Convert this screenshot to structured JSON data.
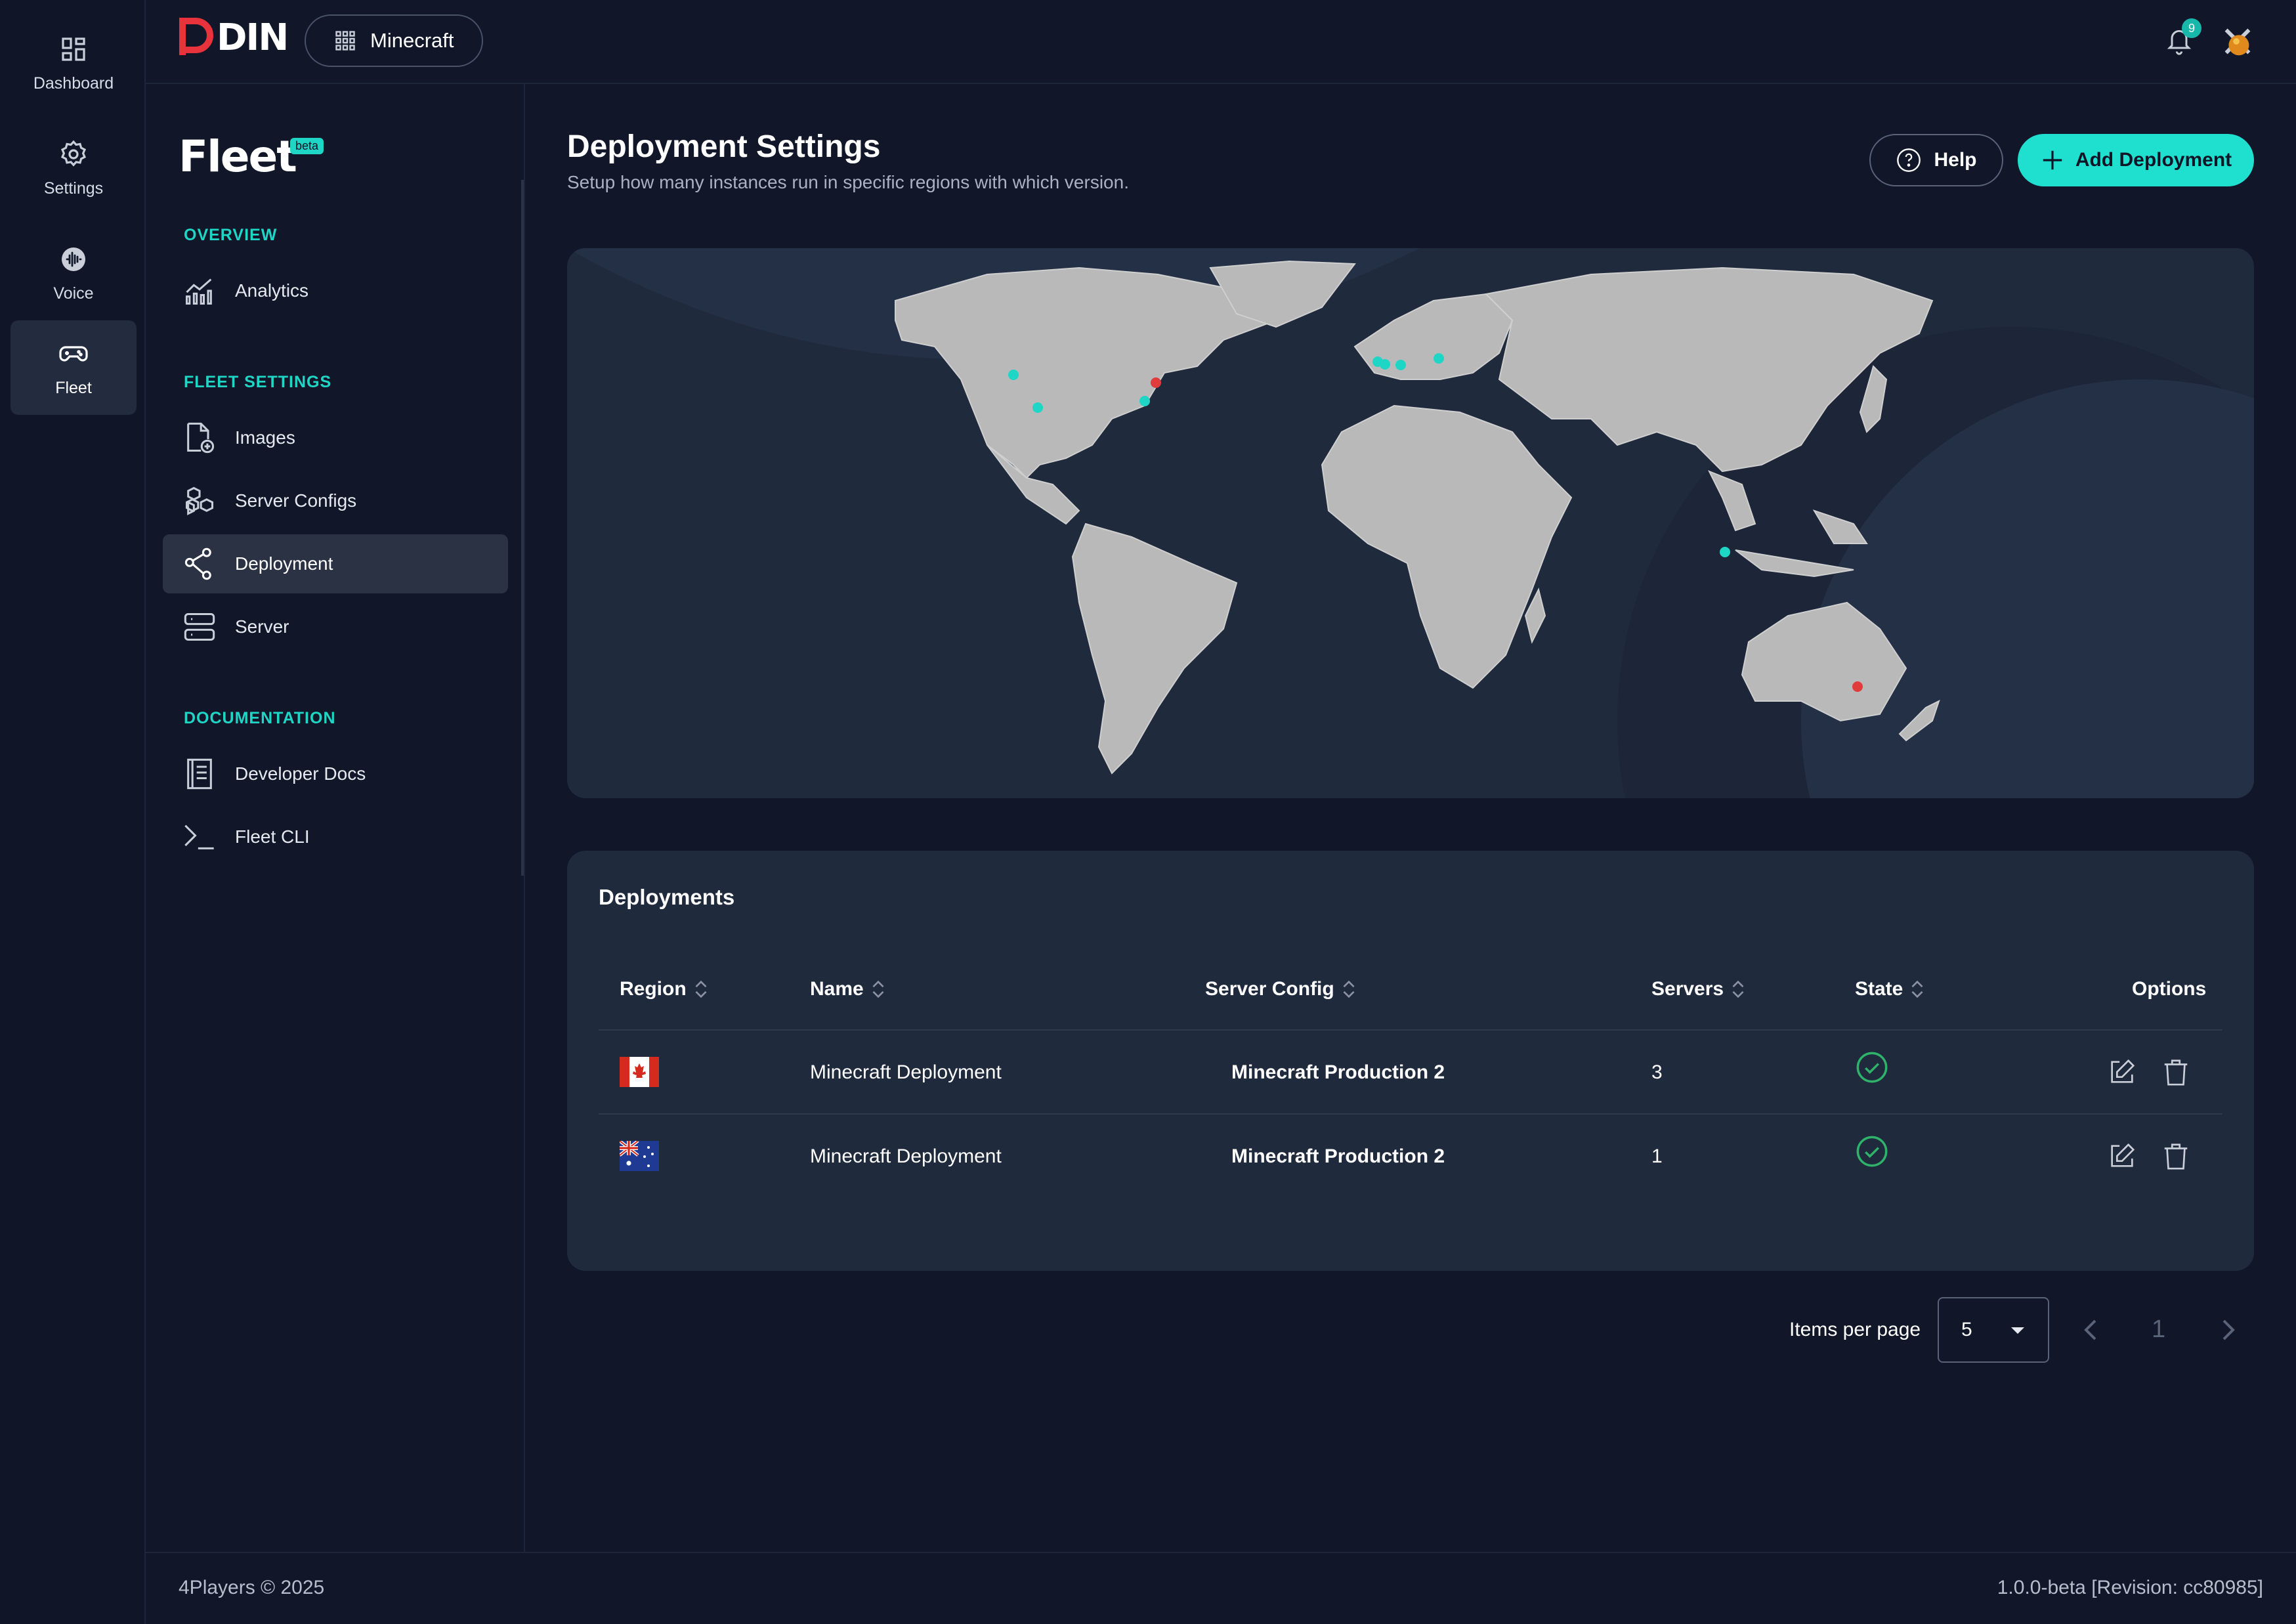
{
  "rail": {
    "items": [
      {
        "label": "Dashboard",
        "icon": "dashboard-icon"
      },
      {
        "label": "Settings",
        "icon": "gear-icon"
      },
      {
        "label": "Voice",
        "icon": "voice-icon"
      },
      {
        "label": "Fleet",
        "icon": "gamepad-icon",
        "active": true
      }
    ]
  },
  "topbar": {
    "logo_text": "DIN",
    "project": "Minecraft",
    "notification_count": "9"
  },
  "subnav": {
    "title": "Fleet",
    "badge": "beta",
    "sections": {
      "overview": "OVERVIEW",
      "fleet_settings": "FLEET SETTINGS",
      "documentation": "DOCUMENTATION"
    },
    "items": {
      "analytics": "Analytics",
      "images": "Images",
      "server_configs": "Server Configs",
      "deployment": "Deployment",
      "server": "Server",
      "developer_docs": "Developer Docs",
      "fleet_cli": "Fleet CLI"
    },
    "active": "deployment"
  },
  "header": {
    "title": "Deployment Settings",
    "subtitle": "Setup how many instances run in specific regions with which version.",
    "help_label": "Help",
    "add_label": "Add Deployment"
  },
  "map": {
    "markers_active_color": "#1fd6c6",
    "markers_alert_color": "#e03c3c"
  },
  "table": {
    "title": "Deployments",
    "columns": {
      "region": "Region",
      "name": "Name",
      "server_config": "Server Config",
      "servers": "Servers",
      "state": "State",
      "options": "Options"
    },
    "rows": [
      {
        "region": "canada-flag",
        "name": "Minecraft Deployment",
        "server_config": "Minecraft Production 2",
        "servers": "3",
        "state": "ok"
      },
      {
        "region": "australia-flag",
        "name": "Minecraft Deployment",
        "server_config": "Minecraft Production 2",
        "servers": "1",
        "state": "ok"
      }
    ]
  },
  "pagination": {
    "items_per_page_label": "Items per page",
    "items_per_page": "5",
    "current_page": "1"
  },
  "footer": {
    "copyright": "4Players © 2025",
    "version": "1.0.0-beta [Revision: cc80985]"
  },
  "colors": {
    "accent": "#1fe0cf",
    "background": "#111729",
    "card": "#1f2a3d",
    "success": "#2fb36a"
  }
}
